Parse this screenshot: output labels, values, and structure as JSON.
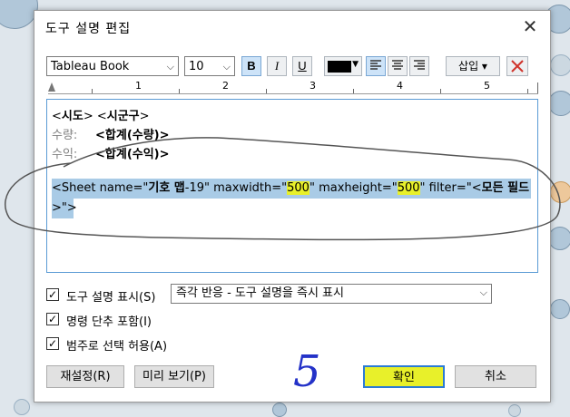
{
  "dialog": {
    "title": "도구 설명 편집",
    "close_glyph": "✕"
  },
  "toolbar": {
    "font": "Tableau Book",
    "size": "10",
    "bold": "B",
    "italic": "I",
    "underline": "U",
    "text_color": "#000000",
    "insert_label": "삽입 ▾",
    "delete_glyph": "✕"
  },
  "ruler": {
    "numbers": [
      "1",
      "2",
      "3",
      "4",
      "5"
    ]
  },
  "editor": {
    "lines": [
      {
        "a": "<",
        "b": "시도",
        "c": "> <",
        "d": "시군구",
        "e": ">"
      },
      {
        "label": "수량:",
        "value": "<합계(수량)>"
      },
      {
        "label": "수익:",
        "value": "<합계(수익)>"
      }
    ],
    "sheet_tag": {
      "part1": "<Sheet name=\"",
      "name": "기호 맵",
      "part2": "-19\" maxwidth=\"",
      "maxwidth": "500",
      "part3": "\" maxheight=\"",
      "maxheight": "500",
      "part4": "\" filter=\"<",
      "filter": "모든 필드",
      "end": ">\">"
    }
  },
  "options": {
    "show_tooltip_label": "도구 설명 표시(S)",
    "show_tooltip_checked": true,
    "mode": "즉각 반응 - 도구 설명을 즉시 표시",
    "include_commands_label": "명령 단추 포함(I)",
    "include_commands_checked": true,
    "allow_legend_label": "범주로 선택 허용(A)",
    "allow_legend_checked": true
  },
  "buttons": {
    "reset": "재설정(R)",
    "preview": "미리 보기(P)",
    "ok": "확인",
    "cancel": "취소"
  },
  "annotation": {
    "handwritten_number": "5"
  },
  "colors": {
    "highlight": "#e8f02a",
    "selection": "#a9cbe6",
    "annotation_pen": "#2432c8"
  }
}
